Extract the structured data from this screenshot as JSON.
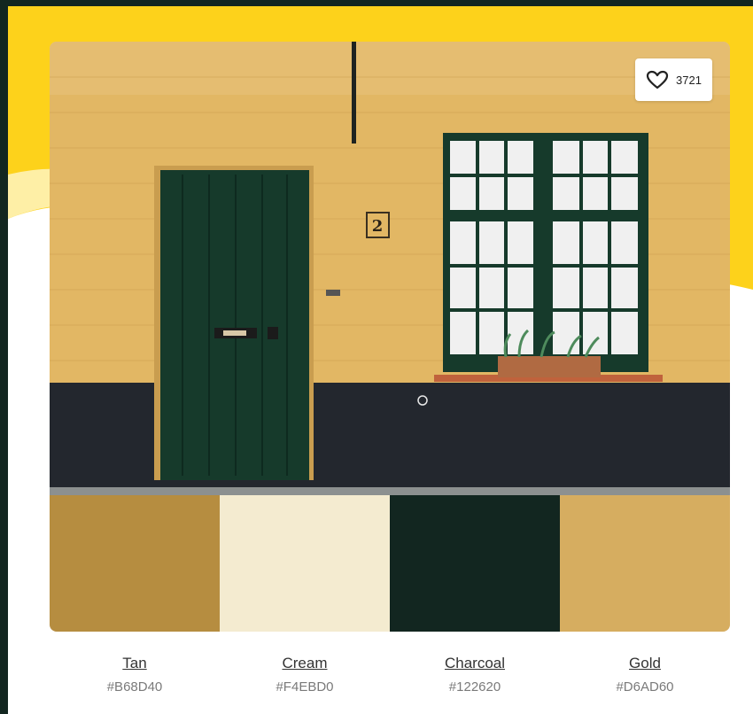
{
  "like": {
    "icon": "heart-icon",
    "count": "3721"
  },
  "palette": [
    {
      "name": "Tan",
      "hex": "#B68D40"
    },
    {
      "name": "Cream",
      "hex": "#F4EBD0"
    },
    {
      "name": "Charcoal",
      "hex": "#122620"
    },
    {
      "name": "Gold",
      "hex": "#D6AD60"
    }
  ],
  "photo": {
    "house_number": "2"
  },
  "colors": {
    "frame": "#122620",
    "accent_yellow": "#FDD21B"
  }
}
